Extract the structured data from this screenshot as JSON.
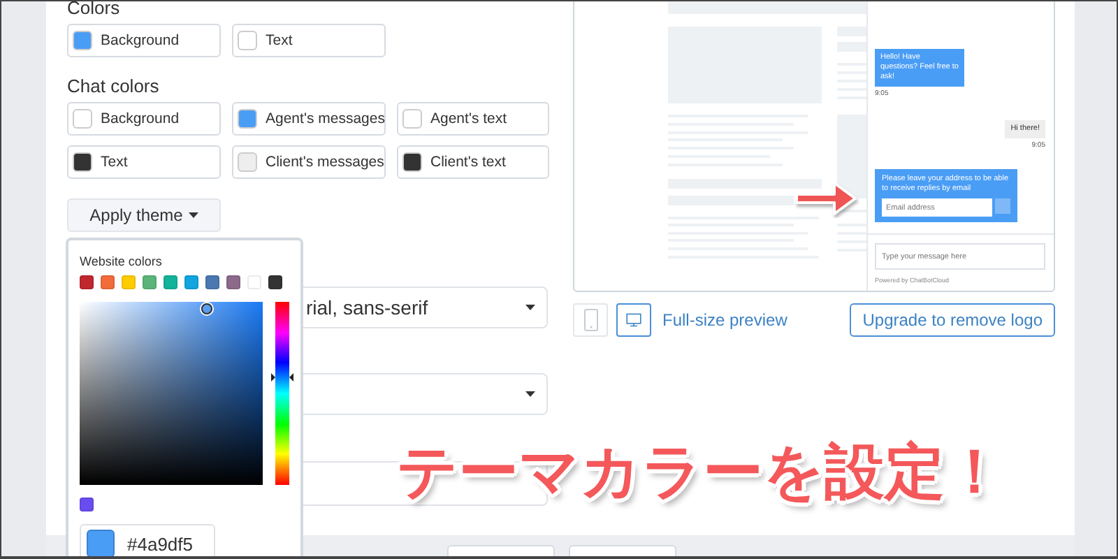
{
  "colors": {
    "heading": "Colors",
    "items": [
      {
        "label": "Background",
        "color": "#4a9df5"
      },
      {
        "label": "Text",
        "color": "#ffffff"
      }
    ]
  },
  "chat_colors": {
    "heading": "Chat colors",
    "items": [
      {
        "label": "Background",
        "color": "#ffffff"
      },
      {
        "label": "Agent's messages",
        "color": "#4a9df5"
      },
      {
        "label": "Agent's text",
        "color": "#ffffff"
      },
      {
        "label": "Text",
        "color": "#333333"
      },
      {
        "label": "Client's messages",
        "color": "#eeeeee"
      },
      {
        "label": "Client's text",
        "color": "#333333"
      }
    ]
  },
  "apply_theme": {
    "label": "Apply theme"
  },
  "font_select": {
    "value": "rial, sans-serif"
  },
  "color_picker": {
    "title": "Website colors",
    "swatches": [
      {
        "color": "#c0282d"
      },
      {
        "color": "#f26b3a"
      },
      {
        "color": "#ffcc00"
      },
      {
        "color": "#5bb57a"
      },
      {
        "color": "#13b29a"
      },
      {
        "color": "#12a5e0"
      },
      {
        "color": "#4a78b0"
      },
      {
        "color": "#8c6a8a"
      },
      {
        "color": "#ffffff"
      },
      {
        "color": "#333333"
      }
    ],
    "hue": {
      "level": 0.59
    },
    "recent": [
      {
        "color": "#6a4df0"
      }
    ],
    "current": {
      "color": "#4a9df5",
      "hex": "#4a9df5"
    }
  },
  "preview": {
    "messages": [
      {
        "kind": "agent",
        "text": "Hello! Have questions? Feel free to ask!",
        "time": "9:05"
      },
      {
        "kind": "client",
        "text": "Hi there!",
        "time": "9:05"
      },
      {
        "kind": "form",
        "text": "Please leave your address to be able to receive replies by email",
        "placeholder": "Email address"
      }
    ],
    "input_placeholder": "Type your message here",
    "powered_by": "Powered by ChatBotCloud",
    "devices": [
      {
        "kind": "phone",
        "selected": false
      },
      {
        "kind": "desktop",
        "selected": true
      }
    ],
    "full_size_link": "Full-size preview",
    "upgrade_button": "Upgrade to remove logo"
  },
  "caption": "テーマカラーを設定！"
}
